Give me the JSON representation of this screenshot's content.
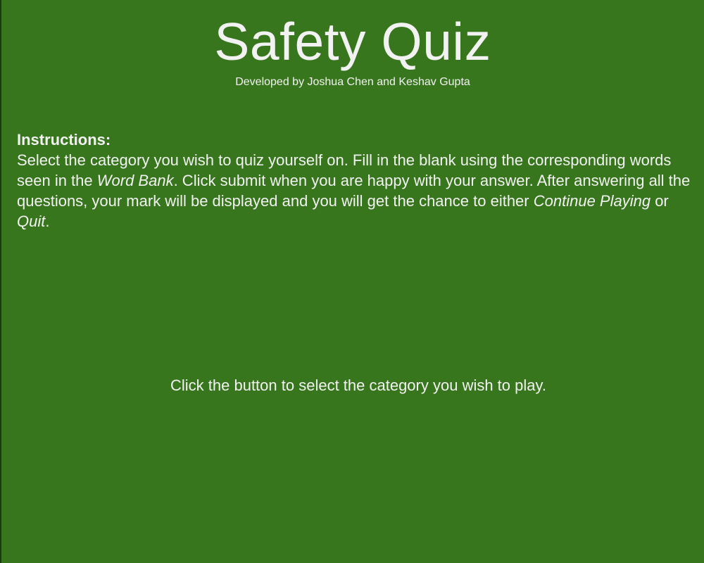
{
  "page": {
    "title": "Safety Quiz",
    "subtitle": "Developed by Joshua Chen and Keshav Gupta"
  },
  "instructions": {
    "heading": "Instructions:",
    "text_1": "Select the category you wish to quiz yourself on. Fill in the blank using the corresponding words seen in the ",
    "word_bank": "Word Bank",
    "text_2": ". Click submit when you are happy with your answer. After answering all the questions, your mark will be displayed and you will get the chance to either ",
    "continue_playing": "Continue Playing",
    "text_3": " or ",
    "quit": "Quit",
    "text_4": "."
  },
  "prompt": {
    "text": "Click the button to select the category you wish to play."
  },
  "colors": {
    "background": "#38761d",
    "text": "#f2f2f2"
  }
}
